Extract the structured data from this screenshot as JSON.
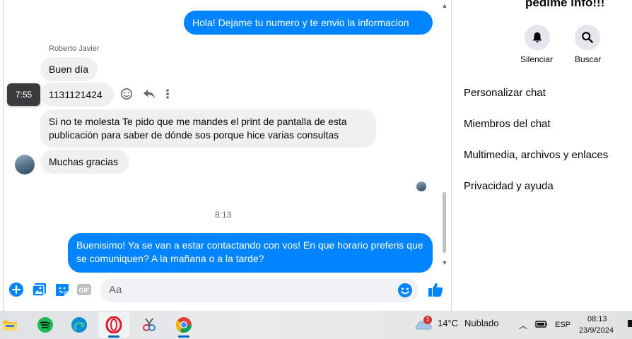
{
  "messages": {
    "outgoing_top": "Hola! Dejame tu numero y te envio la informacion",
    "sender_name": "Roberto Javier",
    "in_1": "Buen día",
    "in_2": "1131121424",
    "in_3": "Si no te molesta Te pido que me mandes el print de pantalla de esta publicación para saber de dónde sos porque hice varias consultas",
    "in_4": "Muchas gracias",
    "tooltip_time": "7:55",
    "divider_time": "8:13",
    "outgoing_bottom": "Buenisimo! Ya se van a estar contactando con vos! En que horario preferis que se comuniquen? A la mañana o a la tarde?"
  },
  "composer": {
    "placeholder": "Aa",
    "icons": [
      "plus-icon",
      "image-icon",
      "sticker-icon",
      "gif-icon",
      "emoji-icon",
      "like-icon"
    ],
    "gif_label": "GIF"
  },
  "panel": {
    "title": "pedime info!!!",
    "mute_label": "Silenciar",
    "search_label": "Buscar",
    "items": [
      "Personalizar chat",
      "Miembros del chat",
      "Multimedia, archivos y enlaces",
      "Privacidad y ayuda"
    ]
  },
  "taskbar": {
    "weather_temp": "14°C",
    "weather_text": "Nublado",
    "weather_badge": "1",
    "lang": "ESP",
    "time": "08:13",
    "date": "23/9/2024"
  },
  "colors": {
    "accent": "#0084ff",
    "bubble_in": "#f0f0f0"
  }
}
